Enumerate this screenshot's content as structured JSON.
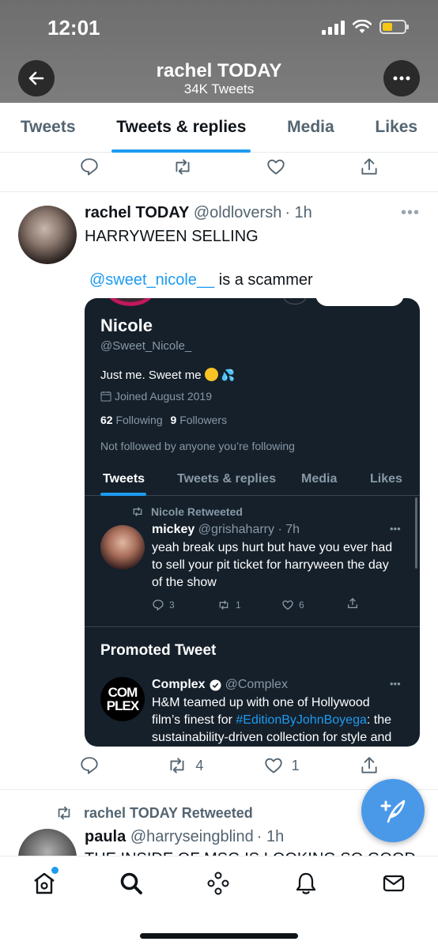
{
  "status_bar": {
    "time": "12:01"
  },
  "header": {
    "title": "rachel TODAY",
    "subtitle": "34K Tweets",
    "back_icon": "arrow-left-icon",
    "more_icon": "ellipsis-icon"
  },
  "tabs": [
    {
      "label": "Tweets",
      "active": false
    },
    {
      "label": "Tweets & replies",
      "active": true
    },
    {
      "label": "Media",
      "active": false
    },
    {
      "label": "Likes",
      "active": false
    }
  ],
  "tweet1": {
    "display_name": "rachel TODAY",
    "handle": "@oldloversh",
    "time": "· 1h",
    "line1": "HARRYWEEN SELLING",
    "mention": "@sweet_nicole__",
    "line2_rest": " is a scammer",
    "reply_count": "",
    "retweet_count": "4",
    "like_count": "1"
  },
  "embed": {
    "name": "Nicole",
    "handle": "@Sweet_Nicole_",
    "bio": "Just me. Sweet me",
    "joined": "Joined August 2019",
    "following_count": "62",
    "following_label": "Following",
    "followers_count": "9",
    "followers_label": "Followers",
    "not_followed": "Not followed by anyone you’re following",
    "tabs": [
      "Tweets",
      "Tweets & replies",
      "Media",
      "Likes"
    ],
    "retweeted_by": "Nicole Retweeted",
    "inner_tweet": {
      "name": "mickey",
      "handle": "@grishaharry",
      "time": "· 7h",
      "text1": "yeah break ups hurt but have you ever had",
      "text2": "to sell your pit ticket for harryween the day",
      "text3": "of the show",
      "replies": "3",
      "retweets": "1",
      "likes": "6"
    },
    "promoted_title": "Promoted Tweet",
    "promo": {
      "logo_line1": "COM",
      "logo_line2": "PLEX",
      "name": "Complex",
      "handle": "@Complex",
      "text1": "H&M teamed up with one of Hollywood",
      "text2_pre": "film’s finest for ",
      "hashtag": "#EditionByJohnBoyega",
      "text2_post": ": the",
      "text3": "sustainability-driven collection for style and"
    }
  },
  "tweet2": {
    "retweeted_by": "rachel TODAY Retweeted",
    "display_name": "paula",
    "handle": "@harryseingblind",
    "time": "· 1h",
    "text": "THE INSIDE OF MSG IS LOOKING SO GOOD"
  },
  "colors": {
    "accent": "#1d9bf0",
    "dark_card": "#15202b",
    "header_gray": "#757575"
  },
  "bottom_nav": [
    "home-icon",
    "search-icon",
    "spaces-icon",
    "notifications-icon",
    "messages-icon"
  ]
}
